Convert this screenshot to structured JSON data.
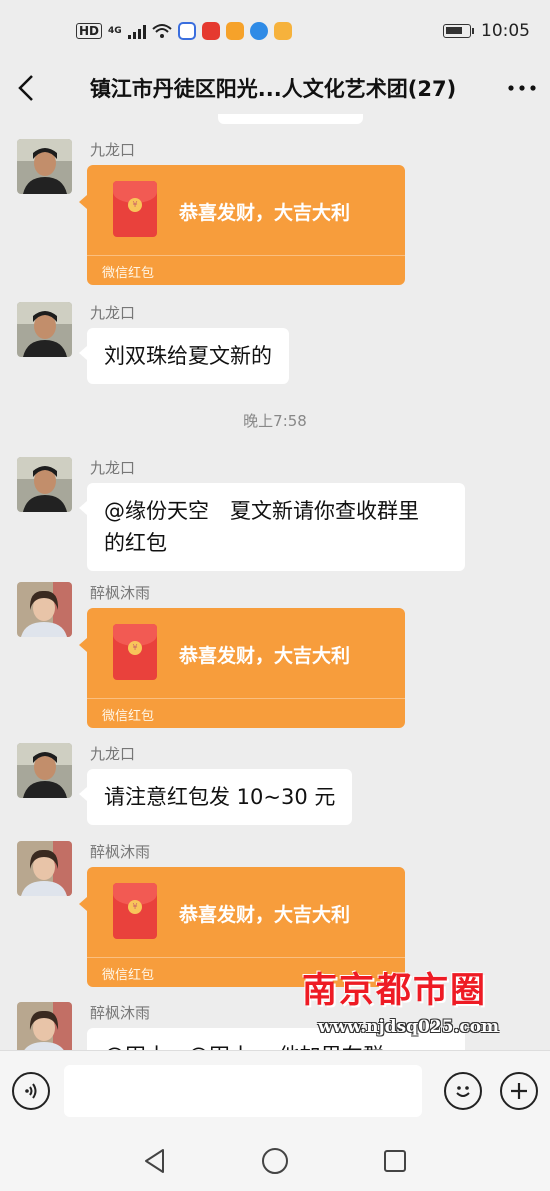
{
  "status_bar": {
    "hd_label": "HD",
    "network_label": "4G",
    "time": "10:05"
  },
  "header": {
    "title": "镇江市丹徒区阳光...人文化艺术团(27)",
    "back_icon": "chevron-left-icon",
    "more_icon": "more-dots-icon"
  },
  "messages": [
    {
      "type": "red_packet",
      "sender": "九龙口",
      "avatar": "man-dark-jacket",
      "text": "恭喜发财，大吉大利",
      "tag": "微信红包"
    },
    {
      "type": "text",
      "sender": "九龙口",
      "avatar": "man-dark-jacket",
      "text": "刘双珠给夏文新的"
    },
    {
      "type": "time",
      "text": "晚上7:58"
    },
    {
      "type": "text",
      "sender": "九龙口",
      "avatar": "man-dark-jacket",
      "text_line1": "@缘份天空　夏文新请你查收群里",
      "text_line2": "的红包"
    },
    {
      "type": "red_packet",
      "sender": "醉枫沐雨",
      "avatar": "woman-light-coat",
      "text": "恭喜发财，大吉大利",
      "tag": "微信红包"
    },
    {
      "type": "text",
      "sender": "九龙口",
      "avatar": "man-dark-jacket",
      "text": "请注意红包发 10~30 元"
    },
    {
      "type": "red_packet",
      "sender": "醉枫沐雨",
      "avatar": "woman-light-coat",
      "text": "恭喜发财，大吉大利",
      "tag": "微信红包"
    },
    {
      "type": "text",
      "sender": "醉枫沐雨",
      "avatar": "woman-light-coat",
      "text": "@田小…@田小… 他加里在群"
    }
  ],
  "watermark": {
    "logo": "南京都市圈",
    "url": "www.njdsq025.com"
  },
  "input_bar": {
    "voice_icon": "voice-icon",
    "emoji_icon": "emoji-icon",
    "plus_icon": "plus-icon",
    "placeholder": ""
  },
  "nav_bar": {
    "back_icon": "triangle-back-icon",
    "home_icon": "circle-home-icon",
    "recents_icon": "square-recents-icon"
  }
}
